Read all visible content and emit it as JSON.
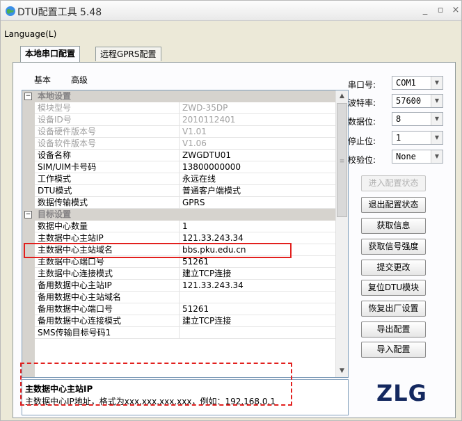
{
  "window": {
    "title": "DTU配置工具 5.48"
  },
  "menu": {
    "language": "Language(L)"
  },
  "tabs": [
    "本地串口配置",
    "远程GPRS配置"
  ],
  "subtabs": [
    "基本",
    "高级"
  ],
  "grid": {
    "cat1": "本地设置",
    "rows1": [
      {
        "name": "模块型号",
        "value": "ZWD-35DP"
      },
      {
        "name": "设备ID号",
        "value": "2010112401"
      },
      {
        "name": "设备硬件版本号",
        "value": "V1.01"
      },
      {
        "name": "设备软件版本号",
        "value": "V1.06"
      },
      {
        "name": "设备名称",
        "value": "ZWGDTU01"
      },
      {
        "name": "SIM/UIM卡号码",
        "value": "13800000000"
      },
      {
        "name": "工作模式",
        "value": "永远在线"
      },
      {
        "name": "DTU模式",
        "value": "普通客户端模式"
      },
      {
        "name": "数据传输模式",
        "value": "GPRS"
      }
    ],
    "cat2": "目标设置",
    "rows2": [
      {
        "name": "数据中心数量",
        "value": "1"
      },
      {
        "name": "主数据中心主站IP",
        "value": "121.33.243.34"
      },
      {
        "name": "主数据中心主站域名",
        "value": "bbs.pku.edu.cn"
      },
      {
        "name": "主数据中心端口号",
        "value": "51261"
      },
      {
        "name": "主数据中心连接模式",
        "value": "建立TCP连接"
      },
      {
        "name": "备用数据中心主站IP",
        "value": "121.33.243.34"
      },
      {
        "name": "备用数据中心主站域名",
        "value": ""
      },
      {
        "name": "备用数据中心端口号",
        "value": "51261"
      },
      {
        "name": "备用数据中心连接模式",
        "value": "建立TCP连接"
      },
      {
        "name": "SMS传输目标号码1",
        "value": ""
      }
    ]
  },
  "description": {
    "title": "主数据中心主站IP",
    "text": "主数据中心IP地址，格式为xxx.xxx.xxx.xxx，例如：192.168.0.1"
  },
  "serial": {
    "port_label": "串口号:",
    "port_value": "COM1",
    "baud_label": "波特率:",
    "baud_value": "57600",
    "data_label": "数据位:",
    "data_value": "8",
    "stop_label": "停止位:",
    "stop_value": "1",
    "parity_label": "校验位:",
    "parity_value": "None"
  },
  "buttons": {
    "enter_config": "进入配置状态",
    "exit_config": "退出配置状态",
    "get_info": "获取信息",
    "get_signal": "获取信号强度",
    "submit": "提交更改",
    "reset_dtu": "复位DTU模块",
    "factory_reset": "恢复出厂设置",
    "export": "导出配置",
    "import": "导入配置"
  },
  "logo": "ZLG",
  "colors": {
    "highlight": "#e2201e",
    "category_bg": "#d6d3ce",
    "logo": "#14285f"
  }
}
